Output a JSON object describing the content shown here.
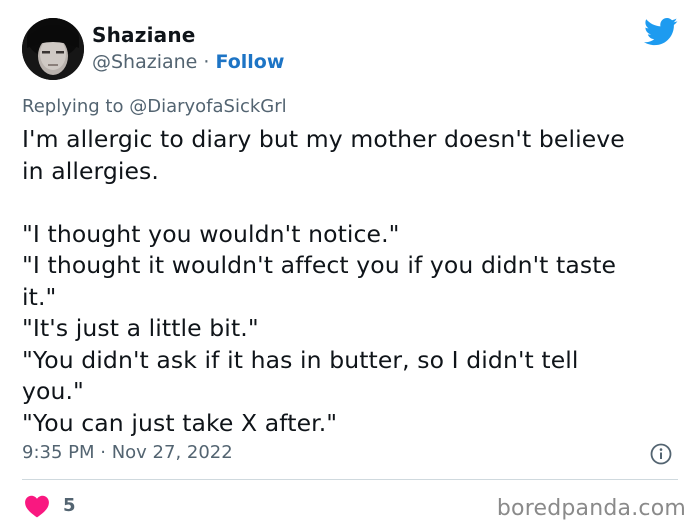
{
  "author": {
    "display_name": "Shaziane",
    "handle": "@Shaziane",
    "separator": " · ",
    "follow_label": "Follow"
  },
  "reply": {
    "prefix": "Replying to ",
    "handle": "@DiaryofaSickGrl"
  },
  "tweet": {
    "lines": [
      "I'm allergic to diary but my mother doesn't believe",
      "in allergies.",
      "",
      "\"I thought you wouldn't notice.\"",
      "\"I thought it wouldn't affect you if you didn't taste",
      "it.\"",
      "\"It's just a little bit.\"",
      "\"You didn't ask if it has in butter, so I didn't tell",
      "you.\"",
      "\"You can just take X after.\""
    ]
  },
  "meta": {
    "timestamp": "9:35 PM · Nov 27, 2022"
  },
  "engagement": {
    "like_count": "5"
  },
  "watermark": "boredpanda.com",
  "colors": {
    "twitter_blue": "#1d9bf0",
    "link_blue": "#1d74c5",
    "heart_red": "#f91880",
    "muted_text": "#536471"
  },
  "icons": [
    "twitter-bird-icon",
    "info-icon",
    "heart-icon"
  ]
}
